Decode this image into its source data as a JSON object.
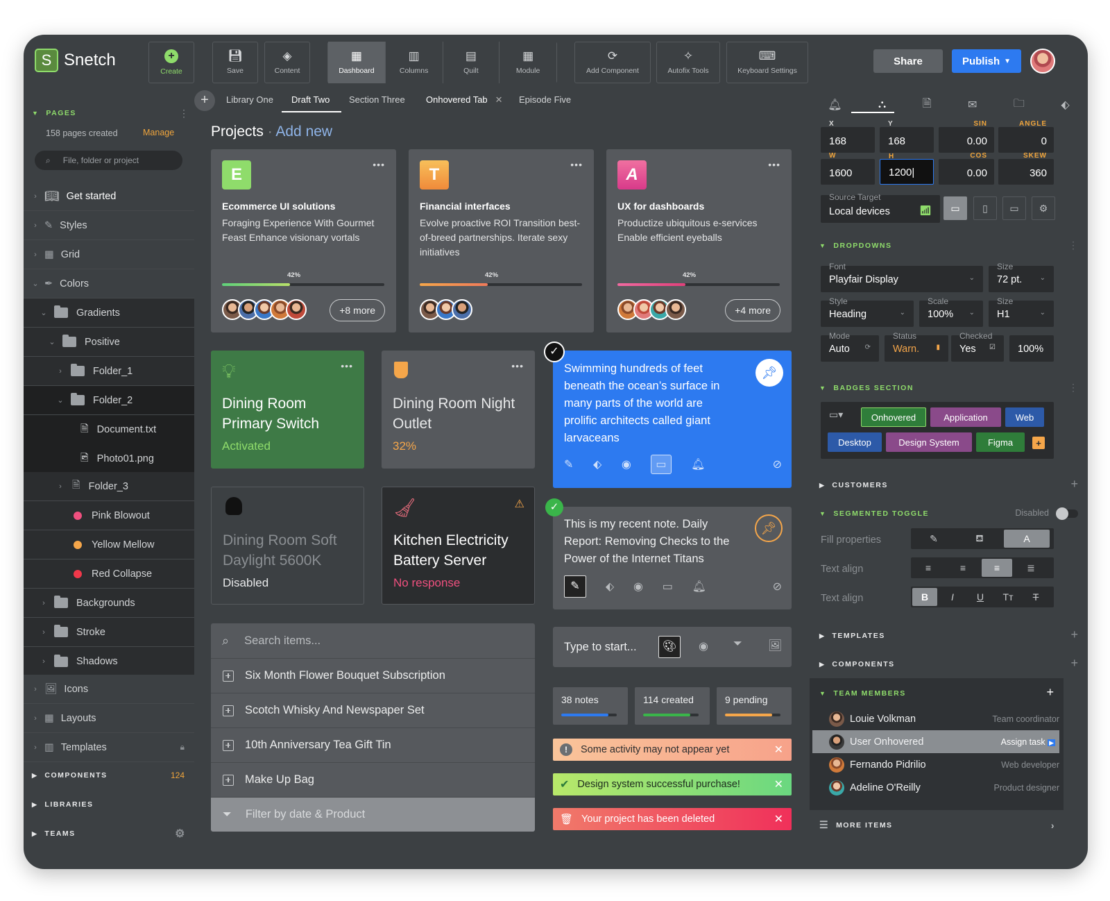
{
  "app": {
    "logo_letter": "S",
    "name": "Snetch"
  },
  "toolbar": {
    "create": "Create",
    "save": "Save",
    "content": "Content",
    "dashboard": "Dashboard",
    "columns": "Columns",
    "quilt": "Quilt",
    "module": "Module",
    "add_component": "Add Component",
    "autofix": "Autofix Tools",
    "keyboard": "Keyboard Settings"
  },
  "header": {
    "share": "Share",
    "publish": "Publish"
  },
  "tabs": [
    {
      "label": "Library One"
    },
    {
      "label": "Draft Two"
    },
    {
      "label": "Section Three"
    },
    {
      "label": "Onhovered Tab"
    },
    {
      "label": "Episode Five"
    }
  ],
  "sidebar": {
    "pages_title": "PAGES",
    "pages_count": "158 pages created",
    "manage": "Manage",
    "search_placeholder": "File, folder or project",
    "items": [
      "Get started",
      "Styles",
      "Grid",
      "Colors",
      "Gradients",
      "Positive",
      "Folder_1",
      "Folder_2",
      "Document.txt",
      "Photo01.png",
      "Folder_3",
      "Pink Blowout",
      "Yellow Mellow",
      "Red Collapse",
      "Backgrounds",
      "Stroke",
      "Shadows",
      "Icons",
      "Layouts",
      "Templates"
    ],
    "components": "COMPONENTS",
    "components_count": "124",
    "libraries": "LIBRARIES",
    "teams": "TEAMS"
  },
  "projects": {
    "title": "Projects",
    "add_new": "Add new",
    "cards": [
      {
        "letter": "E",
        "title": "Ecommerce UI solutions",
        "desc": "Foraging Experience With Gourmet Feast Enhance visionary vortals",
        "percent": "42%",
        "progress": 0.42,
        "more": "+8 more",
        "color": "#8fdc6b"
      },
      {
        "letter": "T",
        "title": "Financial interfaces",
        "desc": "Evolve proactive ROI Transition best-of-breed partnerships. Iterate sexy initiatives",
        "percent": "42%",
        "progress": 0.42,
        "more": "",
        "color": "#f5a64a"
      },
      {
        "letter": "A",
        "title": "UX for dashboards",
        "desc": "Productize ubiquitous e-services Enable efficient eyeballs",
        "percent": "42%",
        "progress": 0.42,
        "more": "+4 more",
        "color": "#f0507f"
      }
    ]
  },
  "tiles": [
    {
      "title": "Dining Room Primary Switch",
      "status": "Activated"
    },
    {
      "title": "Dining Room Night Outlet",
      "status": "32%"
    },
    {
      "title": "Dining Room Soft Daylight 5600K",
      "status": "Disabled"
    },
    {
      "title": "Kitchen Electricity Battery Server",
      "status": "No response"
    }
  ],
  "notes": {
    "blue": "Swimming hundreds of feet beneath the ocean’s surface in many parts of the world are prolific architects called giant larvaceans",
    "gray": "This is my recent note. Daily Report: Removing Checks to the Power of the Internet Titans"
  },
  "search": {
    "placeholder": "Search items...",
    "items": [
      "Six Month Flower Bouquet Subscription",
      "Scotch Whisky And Newspaper Set",
      "10th Anniversary Tea Gift Tin",
      "Make Up Bag"
    ],
    "filter": "Filter by date & Product"
  },
  "typebox": {
    "placeholder": "Type to start..."
  },
  "stats": [
    {
      "label": "38 notes",
      "progress": 0.7
    },
    {
      "label": "114 created",
      "progress": 0.8
    },
    {
      "label": "9 pending",
      "progress": 0.85
    }
  ],
  "alerts": [
    "Some activity may not appear yet",
    "Design system successful purchase!",
    "Your project has been deleted"
  ],
  "panel": {
    "x_label": "X",
    "x": "168",
    "y_label": "Y",
    "y": "168",
    "sin_label": "SIN",
    "sin": "0.00",
    "angle_label": "ANGLE",
    "angle": "0",
    "w_label": "W",
    "w": "1600",
    "h_label": "H",
    "h": "1200|",
    "cos_label": "COS",
    "cos": "0.00",
    "skew_label": "SKEW",
    "skew": "360",
    "source_label": "Source Target",
    "source": "Local devices",
    "dropdowns": "DROPDOWNS",
    "font_label": "Font",
    "font": "Playfair Display",
    "size_label": "Size",
    "size": "72 pt.",
    "style_label": "Style",
    "style": "Heading",
    "scale_label": "Scale",
    "scale": "100%",
    "size2": "H1",
    "mode_label": "Mode",
    "mode": "Auto",
    "status_label": "Status",
    "status": "Warn.",
    "checked_label": "Checked",
    "checked": "Yes",
    "pct": "100%",
    "badges_title": "BADGES SECTION",
    "badges": [
      "Onhovered",
      "Application",
      "Web",
      "Desktop",
      "Design System",
      "Figma"
    ],
    "customers": "CUSTOMERS",
    "segmented": "SEGMENTED TOGGLE",
    "disabled": "Disabled",
    "fill": "Fill properties",
    "text_align": "Text align",
    "text_align2": "Text align",
    "templates": "TEMPLATES",
    "components": "COMPONENTS",
    "team": "TEAM MEMBERS",
    "members": [
      {
        "name": "Louie Volkman",
        "role": "Team coordinator"
      },
      {
        "name": "User Onhovered",
        "role": "Assign task"
      },
      {
        "name": "Fernando Pidrilio",
        "role": "Web developer"
      },
      {
        "name": "Adeline O'Reilly",
        "role": "Product designer"
      }
    ],
    "more_items": "MORE ITEMS"
  }
}
